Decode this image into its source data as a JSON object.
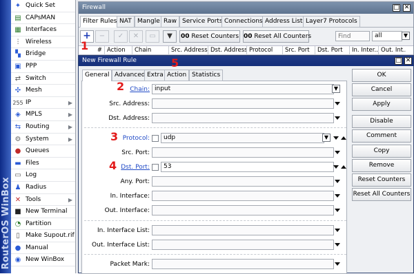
{
  "brand": {
    "vertical": "RouterOS WinBox"
  },
  "sidebar": {
    "items": [
      {
        "label": "Quick Set",
        "icon": "wand-icon",
        "arrow": false
      },
      {
        "label": "CAPsMAN",
        "icon": "capsman-icon",
        "arrow": false
      },
      {
        "label": "Interfaces",
        "icon": "interfaces-icon",
        "arrow": false
      },
      {
        "label": "Wireless",
        "icon": "wireless-icon",
        "arrow": false
      },
      {
        "label": "Bridge",
        "icon": "bridge-icon",
        "arrow": false
      },
      {
        "label": "PPP",
        "icon": "ppp-icon",
        "arrow": false
      },
      {
        "label": "Switch",
        "icon": "switch-icon",
        "arrow": false
      },
      {
        "label": "Mesh",
        "icon": "mesh-icon",
        "arrow": false
      },
      {
        "label": "IP",
        "icon": "ip-icon",
        "arrow": true
      },
      {
        "label": "MPLS",
        "icon": "mpls-icon",
        "arrow": true
      },
      {
        "label": "Routing",
        "icon": "routing-icon",
        "arrow": true
      },
      {
        "label": "System",
        "icon": "system-icon",
        "arrow": true
      },
      {
        "label": "Queues",
        "icon": "queues-icon",
        "arrow": false
      },
      {
        "label": "Files",
        "icon": "files-icon",
        "arrow": false
      },
      {
        "label": "Log",
        "icon": "log-icon",
        "arrow": false
      },
      {
        "label": "Radius",
        "icon": "radius-icon",
        "arrow": false
      },
      {
        "label": "Tools",
        "icon": "tools-icon",
        "arrow": true
      },
      {
        "label": "New Terminal",
        "icon": "terminal-icon",
        "arrow": false
      },
      {
        "label": "Partition",
        "icon": "partition-icon",
        "arrow": false
      },
      {
        "label": "Make Supout.rif",
        "icon": "supout-icon",
        "arrow": false
      },
      {
        "label": "Manual",
        "icon": "manual-icon",
        "arrow": false
      },
      {
        "label": "New WinBox",
        "icon": "winbox-icon",
        "arrow": false
      }
    ]
  },
  "firewall": {
    "title": "Firewall",
    "tabs": [
      "Filter Rules",
      "NAT",
      "Mangle",
      "Raw",
      "Service Ports",
      "Connections",
      "Address Lists",
      "Layer7 Protocols"
    ],
    "reset_counters": "Reset Counters",
    "reset_all": "Reset All Counters",
    "counter_prefix": "00",
    "find_placeholder": "Find",
    "filter_value": "all",
    "columns": [
      "#",
      "Action",
      "Chain",
      "Src. Address",
      "Dst. Address",
      "Protocol",
      "Src. Port",
      "Dst. Port",
      "In. Inter...",
      "Out. Int..."
    ]
  },
  "rule": {
    "title": "New Firewall Rule",
    "tabs": [
      "General",
      "Advanced",
      "Extra",
      "Action",
      "Statistics"
    ],
    "fields": {
      "chain": {
        "label": "Chain:",
        "value": "input"
      },
      "src_address": {
        "label": "Src. Address:"
      },
      "dst_address": {
        "label": "Dst. Address:"
      },
      "protocol": {
        "label": "Protocol:",
        "value": "udp"
      },
      "src_port": {
        "label": "Src. Port:"
      },
      "dst_port": {
        "label": "Dst. Port:",
        "value": "53"
      },
      "any_port": {
        "label": "Any. Port:"
      },
      "in_interface": {
        "label": "In. Interface:"
      },
      "out_interface": {
        "label": "Out. Interface:"
      },
      "in_interface_list": {
        "label": "In. Interface List:"
      },
      "out_interface_list": {
        "label": "Out. Interface List:"
      },
      "packet_mark": {
        "label": "Packet Mark:"
      }
    },
    "buttons": [
      "OK",
      "Cancel",
      "Apply",
      "Disable",
      "Comment",
      "Copy",
      "Remove",
      "Reset Counters",
      "Reset All Counters"
    ]
  },
  "annotations": {
    "one": "1",
    "two": "2",
    "three": "3",
    "four": "4",
    "five": "5",
    "color": "#e21a1a"
  }
}
